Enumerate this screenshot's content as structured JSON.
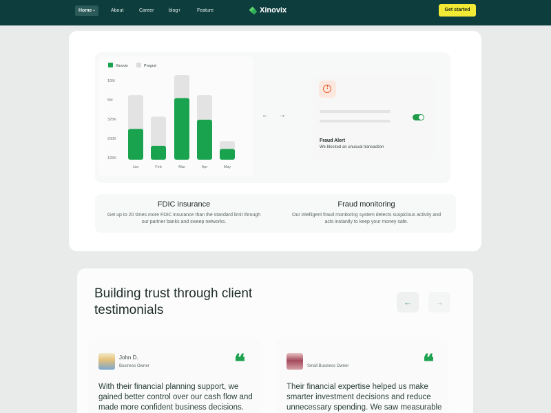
{
  "nav": {
    "items": [
      "Home",
      "About",
      "Career",
      "blog+",
      "Feature"
    ],
    "home_chevron": "⌄",
    "brand": "Xinovix",
    "cta": "Get started"
  },
  "chart": {
    "legend": [
      "Xinovix",
      "Progrst"
    ],
    "colors": {
      "xinovix": "#1aa34f",
      "other": "#e3e3e3"
    }
  },
  "chart_data": {
    "type": "bar",
    "categories": [
      "Jan",
      "Feb",
      "Mar",
      "Apr",
      "May"
    ],
    "ytick_labels": [
      "10M",
      "5M",
      "325K",
      "230K",
      "125K"
    ],
    "series": [
      {
        "name": "Xinovix",
        "values": [
          0.4,
          0.18,
          0.8,
          0.52,
          0.14
        ]
      },
      {
        "name": "Progrst",
        "values": [
          0.84,
          0.56,
          1.1,
          0.84,
          0.24
        ]
      }
    ],
    "ylim": [
      0,
      1.1
    ],
    "grid": false,
    "legend_position": "top-left"
  },
  "carousel": {
    "prev_icon": "←",
    "next_icon": "→"
  },
  "fraud_card": {
    "alert_icon": "!",
    "title": "Fraud Alert",
    "subtitle": "We blocked an unusual transaction",
    "toggle_on": true
  },
  "features": [
    {
      "title": "FDIC insurance",
      "desc_line1": "Get up to 20 times more FDIC insurance than the standard limit through",
      "desc_line2": "our partner banks and sweep networks."
    },
    {
      "title": "Fraud monitoring",
      "desc_line1": "Our intelligent fraud monitoring system detects suspicious activity and",
      "desc_line2": "acts instantly to keep your money safe."
    }
  ],
  "testimonials": {
    "heading_line1": "Building trust through client",
    "heading_line2": "testimonials",
    "prev_icon": "←",
    "next_icon": "→",
    "quote_mark": "❝",
    "items": [
      {
        "name": "John D.",
        "role": "Business Owner",
        "text": "With their financial planning support, we gained better control over our cash flow and made more confident business decisions. The results were both immediate and long-term."
      },
      {
        "name": "",
        "role": "Small Business Owner",
        "text": "Their financial expertise helped us make smarter investment decisions and reduce unnecessary spending. We saw measurable improvements within weeks."
      }
    ]
  }
}
